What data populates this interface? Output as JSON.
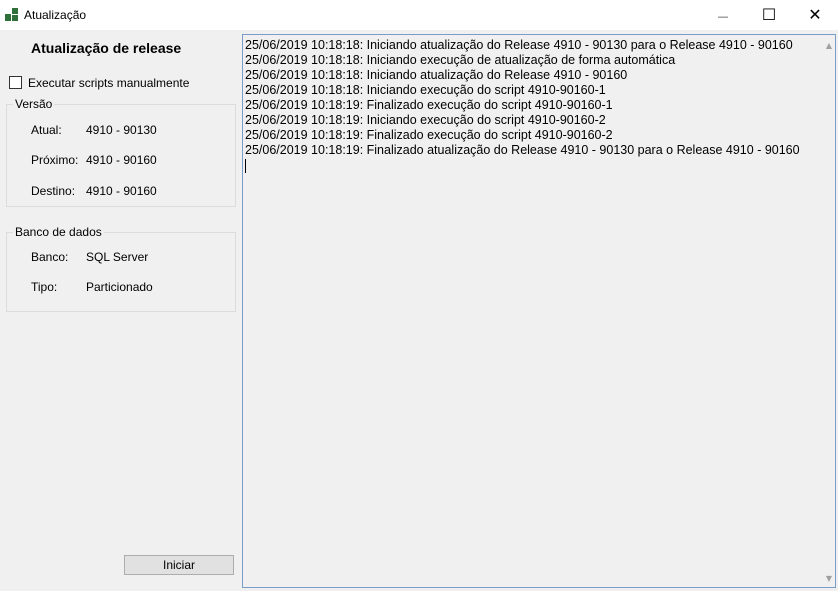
{
  "window": {
    "title": "Atualização",
    "minimize_glyph": "—",
    "maximize_glyph": "☐",
    "close_glyph": "✕"
  },
  "panel": {
    "title": "Atualização de release",
    "manual_scripts_checkbox": {
      "label": "Executar scripts manualmente",
      "checked": false
    },
    "version_group": {
      "title": "Versão",
      "fields": [
        {
          "label": "Atual:",
          "value": "4910 - 90130"
        },
        {
          "label": "Próximo:",
          "value": "4910 - 90160"
        },
        {
          "label": "Destino:",
          "value": "4910 - 90160"
        }
      ]
    },
    "database_group": {
      "title": "Banco de dados",
      "fields": [
        {
          "label": "Banco:",
          "value": "SQL Server"
        },
        {
          "label": "Tipo:",
          "value": "Particionado"
        }
      ]
    },
    "start_button": "Iniciar"
  },
  "log": {
    "lines": [
      "25/06/2019 10:18:18: Iniciando atualização do Release 4910 - 90130 para o Release 4910 - 90160",
      "25/06/2019 10:18:18: Iniciando execução de atualização de forma automática",
      "25/06/2019 10:18:18: Iniciando atualização do Release 4910 - 90160",
      "25/06/2019 10:18:18: Iniciando execução do script 4910-90160-1",
      "25/06/2019 10:18:19: Finalizado execução do script 4910-90160-1",
      "25/06/2019 10:18:19: Iniciando execução do script 4910-90160-2",
      "25/06/2019 10:18:19: Finalizado execução do script 4910-90160-2",
      "25/06/2019 10:18:19: Finalizado atualização do Release 4910 - 90130 para o Release 4910 - 90160"
    ],
    "scroll_up_glyph": "▲",
    "scroll_down_glyph": "▼"
  },
  "colors": {
    "window_bg": "#f0f0f0",
    "log_border": "#7a9cc6",
    "icon_green": "#2f6f3a"
  }
}
